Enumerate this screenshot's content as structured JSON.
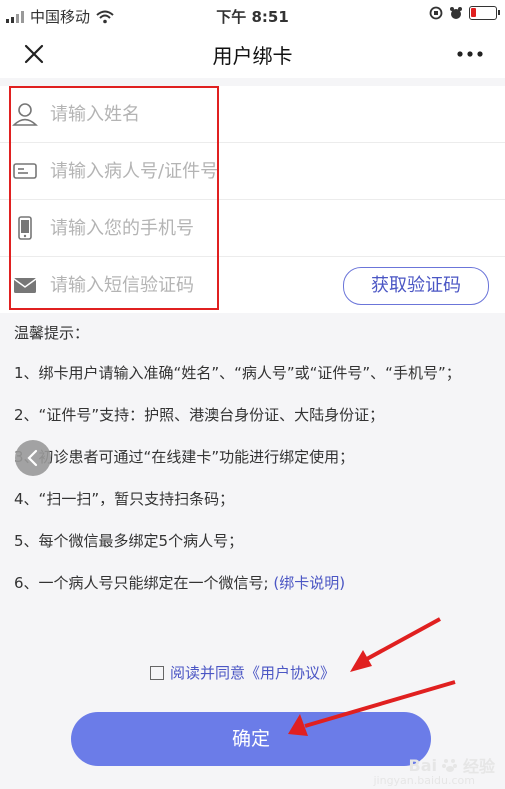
{
  "status": {
    "carrier": "中国移动",
    "time": "下午 8:51"
  },
  "nav": {
    "title": "用户绑卡",
    "close_icon": "close-icon",
    "more_icon": "more-icon"
  },
  "form": {
    "name_placeholder": "请输入姓名",
    "id_placeholder": "请输入病人号/证件号",
    "phone_placeholder": "请输入您的手机号",
    "code_placeholder": "请输入短信验证码",
    "get_code_label": "获取验证码"
  },
  "tips": {
    "title": "温馨提示：",
    "items": [
      "1、绑卡用户请输入准确“姓名”、“病人号”或“证件号”、“手机号”；",
      "2、“证件号”支持：护照、港澳台身份证、大陆身份证；",
      "3、初诊患者可通过“在线建卡”功能进行绑定使用；",
      "4、“扫一扫”，暂只支持扫条码；",
      "5、每个微信最多绑定5个病人号；",
      "6、一个病人号只能绑定在一个微信号;"
    ],
    "link": "(绑卡说明)"
  },
  "agree": {
    "label": "阅读并同意《用户协议》"
  },
  "confirm_label": "确定",
  "watermark": {
    "brand": "Bai",
    "brand2": "经验",
    "sub": "jingyan.baidu.com"
  },
  "colors": {
    "accent": "#6b7ce8",
    "link": "#4b56c4",
    "annotation": "#e02020"
  }
}
